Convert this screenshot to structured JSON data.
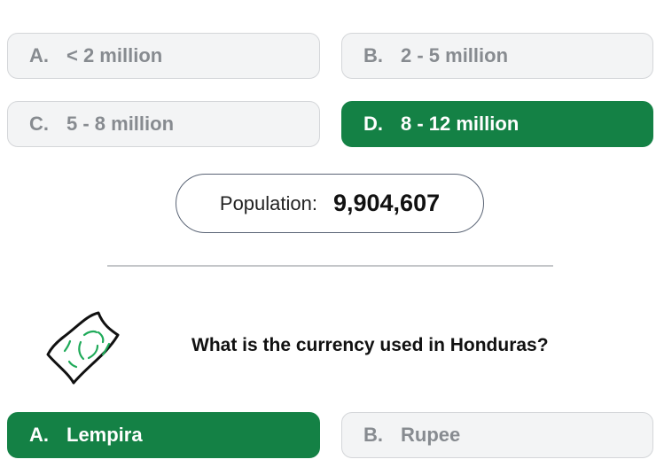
{
  "population_question": {
    "options": [
      {
        "letter": "A.",
        "text": "< 2 million",
        "correct": false
      },
      {
        "letter": "B.",
        "text": "2 - 5 million",
        "correct": false
      },
      {
        "letter": "C.",
        "text": "5 - 8 million",
        "correct": false
      },
      {
        "letter": "D.",
        "text": "8 - 12 million",
        "correct": true
      }
    ],
    "result_label": "Population:",
    "result_value": "9,904,607"
  },
  "currency_question": {
    "icon": "banknote-icon",
    "text": "What is the currency used in Honduras?",
    "options": [
      {
        "letter": "A.",
        "text": "Lempira",
        "correct": true
      },
      {
        "letter": "B.",
        "text": "Rupee",
        "correct": false
      }
    ]
  },
  "colors": {
    "correct": "#148145",
    "neutral_bg": "#f3f4f5",
    "neutral_text": "#878b90",
    "icon_green": "#1faa59"
  }
}
